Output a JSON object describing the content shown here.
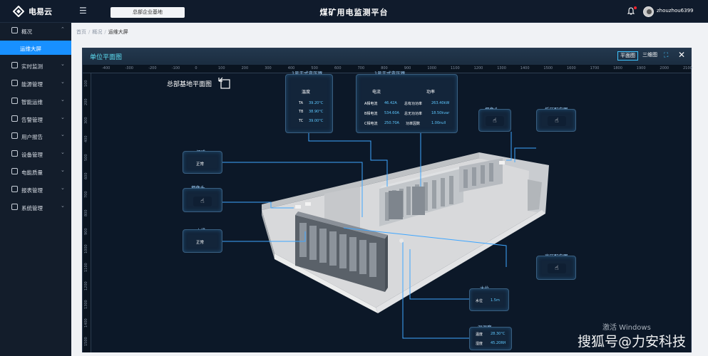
{
  "app": {
    "logo_text": "电易云",
    "title": "煤矿用电监测平台",
    "org_select": "总部企业基地",
    "username": "zhouzhou6399"
  },
  "sidebar": {
    "items": [
      {
        "label": "概况",
        "icon": "dashboard-icon"
      },
      {
        "label": "运维大屏",
        "icon": ""
      },
      {
        "label": "实时监测",
        "icon": "monitor-icon"
      },
      {
        "label": "能源管理",
        "icon": "energy-icon"
      },
      {
        "label": "智能运维",
        "icon": "tools-icon"
      },
      {
        "label": "告警管理",
        "icon": "alarm-icon"
      },
      {
        "label": "用户报告",
        "icon": "report-icon"
      },
      {
        "label": "设备管理",
        "icon": "device-icon"
      },
      {
        "label": "电能质量",
        "icon": "quality-icon"
      },
      {
        "label": "报表管理",
        "icon": "table-icon"
      },
      {
        "label": "系统管理",
        "icon": "settings-icon"
      }
    ]
  },
  "breadcrumb": {
    "items": [
      "首页",
      "概况",
      "运维大屏"
    ]
  },
  "panel": {
    "title": "单位平面图",
    "view_2d": "平面图",
    "view_3d": "三维图"
  },
  "ruler": {
    "top": [
      "-400",
      "-300",
      "-200",
      "-100",
      "0",
      "100",
      "200",
      "300",
      "400",
      "500",
      "600",
      "700",
      "800",
      "900",
      "1000",
      "1100",
      "1200",
      "1300",
      "1400",
      "1500",
      "1600",
      "1700",
      "1800",
      "1900",
      "2000",
      "2100"
    ],
    "left": [
      "100",
      "200",
      "300",
      "400",
      "500",
      "600",
      "700",
      "800",
      "900",
      "1000",
      "1100",
      "1200",
      "1300",
      "1400",
      "1500"
    ]
  },
  "plan": {
    "title": "总部基地平面图"
  },
  "transformer1": {
    "title": "1号干式变压器",
    "header": "温度",
    "rows": [
      {
        "name": "TA",
        "value": "39.20°C"
      },
      {
        "name": "TB",
        "value": "38.90°C"
      },
      {
        "name": "TC",
        "value": "39.00°C"
      }
    ]
  },
  "transformer2": {
    "title": "1号干式变压器",
    "col1": "电流",
    "col2": "功率",
    "rows": [
      {
        "name": "A相电流",
        "value": "46.42A",
        "name2": "总有功功率",
        "value2": "263.40kW"
      },
      {
        "name": "B相电流",
        "value": "534.60A",
        "name2": "总无功功率",
        "value2": "18.50kvar"
      },
      {
        "name": "C相电流",
        "value": "250.70A",
        "name2": "功率因数",
        "value2": "1.00null"
      }
    ]
  },
  "nodes": {
    "smoke": {
      "title": "烟感",
      "value": "正常"
    },
    "camera1": {
      "title": "摄像头"
    },
    "water": {
      "title": "水浸",
      "value": "正常"
    },
    "camera2": {
      "title": "摄像头"
    },
    "lowcab": {
      "title": "低压配电图"
    },
    "highcab": {
      "title": "高压配电图"
    },
    "level": {
      "title": "水位",
      "label": "水位",
      "value": "1.5m"
    },
    "thermo": {
      "title": "温湿度",
      "label1": "温度",
      "value1": "28.30°C",
      "label2": "湿度",
      "value2": "45.20RH"
    }
  },
  "overlay": {
    "windows": "激活 Windows",
    "watermark": "搜狐号@力安科技"
  }
}
